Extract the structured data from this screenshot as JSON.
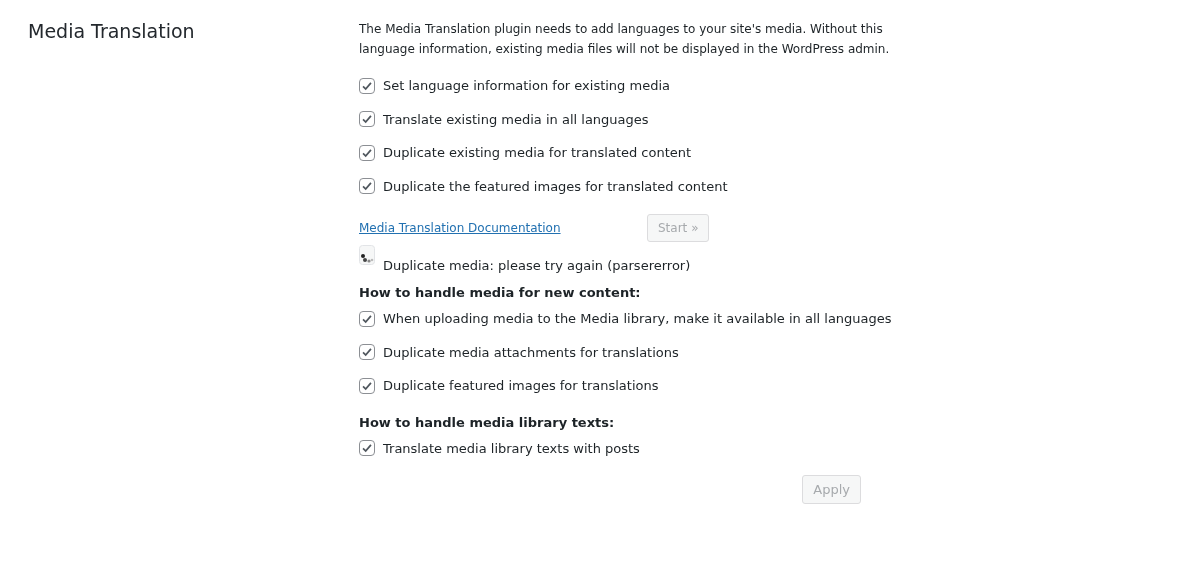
{
  "title": "Media Translation",
  "intro": "The Media Translation plugin needs to add languages to your site's media. Without this language information, existing media files will not be displayed in the WordPress admin.",
  "existing_options": [
    {
      "label": "Set language information for existing media",
      "checked": true
    },
    {
      "label": "Translate existing media in all languages",
      "checked": true
    },
    {
      "label": "Duplicate existing media for translated content",
      "checked": true
    },
    {
      "label": "Duplicate the featured images for translated content",
      "checked": true
    }
  ],
  "documentation_link": "Media Translation Documentation",
  "start_button": {
    "label": "Start »",
    "disabled": true
  },
  "status_message": "Duplicate media: please try again (parsererror)",
  "new_content": {
    "heading": "How to handle media for new content:",
    "options": [
      {
        "label": "When uploading media to the Media library, make it available in all languages",
        "checked": true
      },
      {
        "label": "Duplicate media attachments for translations",
        "checked": true
      },
      {
        "label": "Duplicate featured images for translations",
        "checked": true
      }
    ]
  },
  "library_texts": {
    "heading": "How to handle media library texts:",
    "options": [
      {
        "label": "Translate media library texts with posts",
        "checked": true
      }
    ]
  },
  "apply_button": {
    "label": "Apply",
    "disabled": true
  }
}
